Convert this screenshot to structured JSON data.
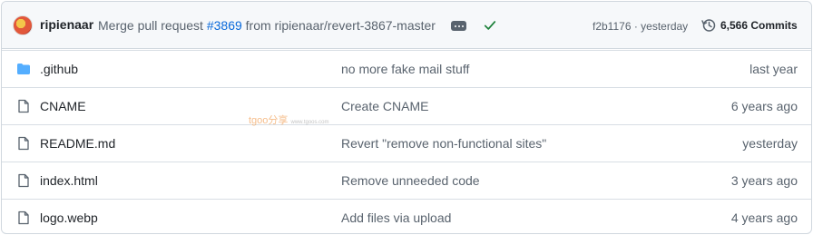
{
  "latest_commit": {
    "author": "ripienaar",
    "message_prefix": "Merge pull request ",
    "pr_link": "#3869",
    "message_suffix": " from ripienaar/revert-3867-master",
    "sha": "f2b1176 · yesterday",
    "commits_count": "6,566 Commits",
    "status": "success"
  },
  "files": [
    {
      "name": ".github",
      "type": "folder",
      "icon": "folder-icon",
      "message": "no more fake mail stuff",
      "age": "last year"
    },
    {
      "name": "CNAME",
      "type": "file",
      "icon": "file-icon",
      "message": "Create CNAME",
      "age": "6 years ago"
    },
    {
      "name": "README.md",
      "type": "file",
      "icon": "file-icon",
      "message": "Revert \"remove non-functional sites\"",
      "age": "yesterday"
    },
    {
      "name": "index.html",
      "type": "file",
      "icon": "file-icon",
      "message": "Remove unneeded code",
      "age": "3 years ago"
    },
    {
      "name": "logo.webp",
      "type": "file",
      "icon": "file-icon",
      "message": "Add files via upload",
      "age": "4 years ago"
    }
  ],
  "watermark": {
    "brand": "tgoo分享",
    "url": "www.tgoos.com"
  },
  "colors": {
    "link": "#0969da",
    "muted": "#59636e",
    "success": "#1a7f37",
    "folder": "#54aeff"
  }
}
